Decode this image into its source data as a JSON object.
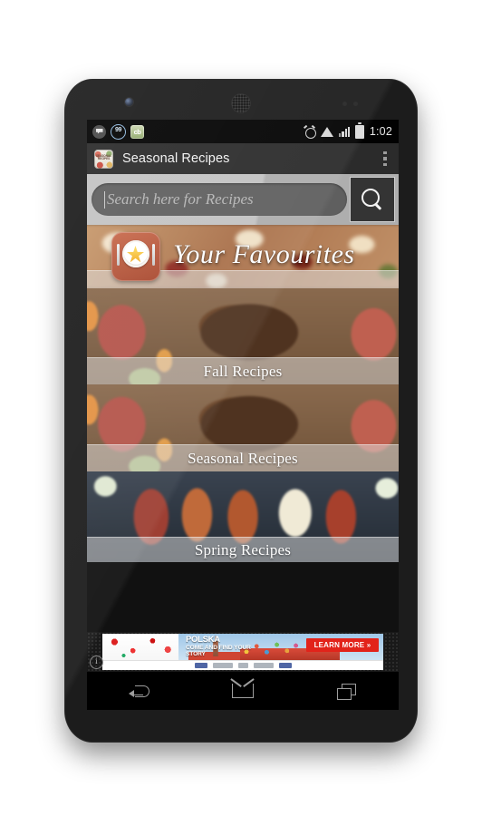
{
  "device": {
    "name": "android-phone",
    "camera": "front-camera",
    "speaker": "earpiece-speaker"
  },
  "status_bar": {
    "left_icons": [
      {
        "name": "messenger-icon",
        "label": ""
      },
      {
        "name": "badge-99-icon",
        "label": "99"
      },
      {
        "name": "cb-app-icon",
        "label": "cb"
      }
    ],
    "right_icons": [
      {
        "name": "alarm-icon"
      },
      {
        "name": "wifi-icon"
      },
      {
        "name": "signal-icon"
      },
      {
        "name": "battery-icon"
      }
    ],
    "time": "1:02"
  },
  "action_bar": {
    "app_icon_label": "SEASONAL RECIPES",
    "title": "Seasonal Recipes",
    "overflow": "overflow-menu"
  },
  "search": {
    "placeholder": "Search here for Recipes",
    "value": "",
    "button_icon": "search-icon"
  },
  "cards": [
    {
      "id": "your-favourites",
      "label": "Your Favourites",
      "icon": "plate-star-cutlery-icon",
      "style": "script"
    },
    {
      "id": "fall-recipes",
      "label": "Fall Recipes",
      "style": "serif"
    },
    {
      "id": "seasonal-recipes",
      "label": "Seasonal Recipes",
      "style": "serif"
    },
    {
      "id": "spring-recipes",
      "label": "Spring Recipes",
      "style": "serif"
    }
  ],
  "ad": {
    "headline": "POLSKA",
    "subline": "COME AND FIND YOUR STORY",
    "cta": "LEARN MORE »",
    "info_icon": "ad-info-icon",
    "accent_color": "#e2231a"
  },
  "nav_bar": {
    "back": "back-button",
    "home": "home-button",
    "recents": "recents-button"
  },
  "colors": {
    "action_bar": "#2b2b2b",
    "status_bar": "#020202",
    "search_row": "#b9b9b9",
    "search_field": "#5f5f5f",
    "search_button": "#343434",
    "band": "rgba(225,225,225,.50)"
  }
}
